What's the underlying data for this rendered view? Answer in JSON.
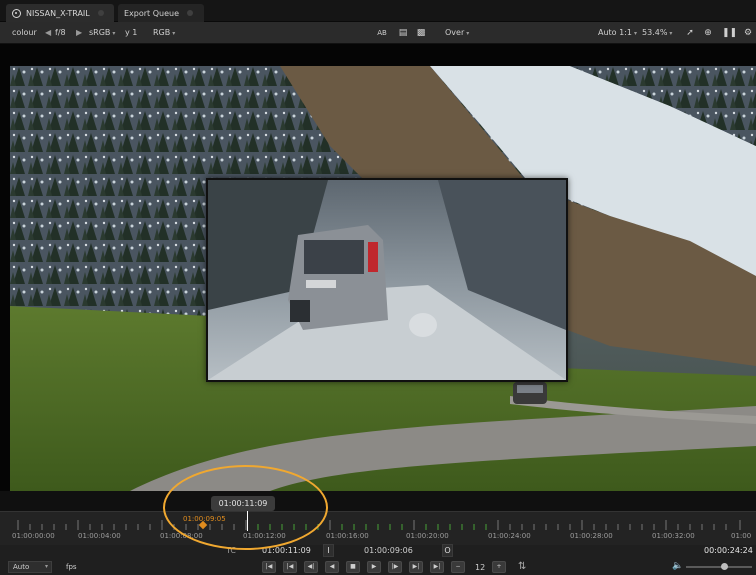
{
  "tabs": [
    {
      "label": "NISSAN_X-TRAIL",
      "icon": "eye-icon",
      "active": true
    },
    {
      "label": "Export Queue",
      "active": false
    }
  ],
  "toolbar": {
    "channel": "colour",
    "fstop": "f/8",
    "colorspace": "sRGB",
    "gamma": "y 1",
    "channels": "RGB",
    "compare_mode": "Over",
    "proxy": "Auto 1:1",
    "zoom": "53.4%",
    "icons": [
      "ab-compare-icon",
      "wipe-icon",
      "layers-icon",
      "color-picker-icon",
      "crosshair-icon",
      "pause-icon",
      "gear-icon"
    ]
  },
  "viewer": {
    "background": "aerial mountain forest road",
    "overlay": "silver SUV in snow"
  },
  "timeline": {
    "hover_timecode": "01:00:11:09",
    "marker_timecode": "01:00:09:05",
    "marker_color": "#e08c1e",
    "tick_labels": [
      "01:00:00:00",
      "01:00:04:00",
      "01:00:08:00",
      "01:00:12:00",
      "01:00:16:00",
      "01:00:20:00",
      "01:00:24:00",
      "01:00:28:00",
      "01:00:32:00",
      "01:00"
    ],
    "tc_label": "TC",
    "current_time": "01:00:11:09",
    "in_label": "I",
    "in_point": "01:00:09:06",
    "out_label": "O",
    "duration": "00:00:24:24"
  },
  "transport": {
    "fps_select": "Auto",
    "fps_label": "fps",
    "buttons": [
      "skip-start-icon",
      "prev-marker-icon",
      "step-back-icon",
      "play-reverse-icon",
      "stop-icon",
      "play-icon",
      "step-forward-icon",
      "next-marker-icon",
      "skip-end-icon",
      "decrement-icon"
    ],
    "step_value": "12",
    "volume_icon": "speaker-icon"
  }
}
